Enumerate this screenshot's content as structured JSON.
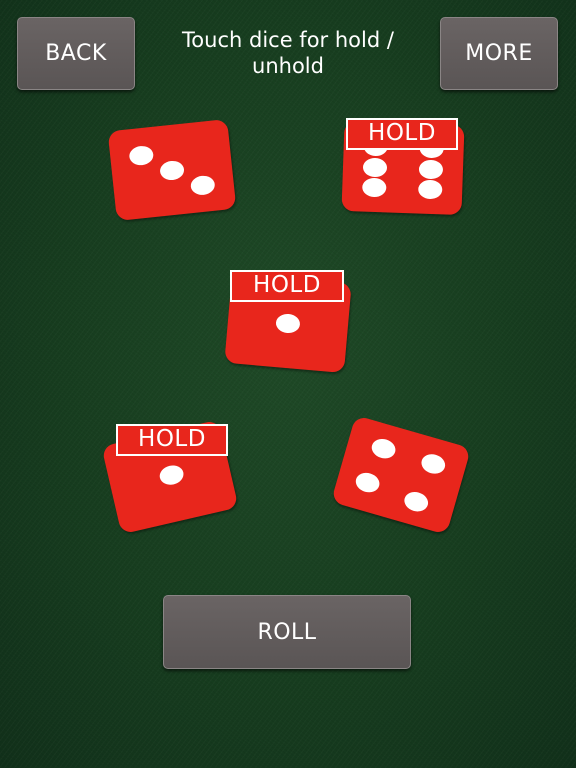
{
  "header": {
    "back_label": "BACK",
    "more_label": "MORE",
    "instructions": "Touch dice for hold / unhold"
  },
  "dice": [
    {
      "value": 3,
      "held": false
    },
    {
      "value": 6,
      "held": true,
      "hold_label": "HOLD"
    },
    {
      "value": 1,
      "held": true,
      "hold_label": "HOLD"
    },
    {
      "value": 1,
      "held": true,
      "hold_label": "HOLD"
    },
    {
      "value": 4,
      "held": false
    }
  ],
  "footer": {
    "roll_label": "ROLL"
  },
  "colors": {
    "felt": "#173d1f",
    "die": "#e8261c",
    "pip": "#ffffff",
    "button": "#5f5a5a"
  }
}
